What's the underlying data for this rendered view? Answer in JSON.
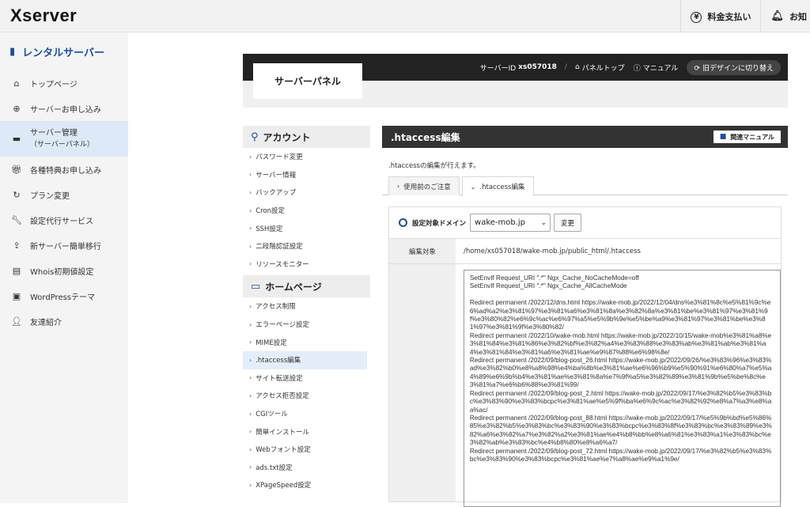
{
  "topbar": {
    "logo": "Xserver",
    "buttons": [
      {
        "label": "料金支払い",
        "icon": "yen-icon"
      },
      {
        "label": "お知",
        "icon": "bell-icon"
      }
    ]
  },
  "sidebar": {
    "title": "レンタルサーバー",
    "items": [
      {
        "label": "トップページ",
        "icon": "home-icon"
      },
      {
        "label": "サーバーお申し込み",
        "icon": "plus-circle-icon"
      },
      {
        "label": "サーバー管理",
        "sub": "（サーバーパネル）",
        "icon": "server-icon",
        "active": true
      },
      {
        "label": "各種特典お申し込み",
        "icon": "gift-icon"
      },
      {
        "label": "プラン変更",
        "icon": "refresh-icon"
      },
      {
        "label": "設定代行サービス",
        "icon": "wrench-icon"
      },
      {
        "label": "新サーバー簡単移行",
        "icon": "migrate-icon"
      },
      {
        "label": "Whois初期値設定",
        "icon": "document-icon"
      },
      {
        "label": "WordPressテーマ",
        "icon": "window-icon"
      },
      {
        "label": "友達紹介",
        "icon": "friend-icon"
      }
    ]
  },
  "panel": {
    "tab": "サーバーパネル",
    "server_id_label": "サーバーID",
    "server_id": "xs057018",
    "sep": "/",
    "panel_top": "パネルトップ",
    "manual": "マニュアル",
    "old_design": "旧デザインに切り替え"
  },
  "menu": {
    "account_title": "アカウント",
    "account_items": [
      "パスワード変更",
      "サーバー情報",
      "バックアップ",
      "Cron設定",
      "SSH設定",
      "二段階認証設定",
      "リソースモニター"
    ],
    "homepage_title": "ホームページ",
    "homepage_items": [
      "アクセス制限",
      "エラーページ設定",
      "MIME設定",
      ".htaccess編集",
      "サイト転送設定",
      "アクセス拒否設定",
      "CGIツール",
      "簡単インストール",
      "Webフォント設定",
      "ads.txt設定",
      "XPageSpeed設定"
    ]
  },
  "content": {
    "title": ".htaccess編集",
    "manual_btn": "関連マニュアル",
    "description": ".htaccessの編集が行えます。",
    "tabs": [
      ".htaccess編集"
    ],
    "tab_notes": "使用前のご注意",
    "domain_label": "設定対象ドメイン",
    "domain_value": "wake-mob.jp",
    "change_btn": "変更",
    "target_label": "編集対象",
    "target_value": "/home/xs057018/wake-mob.jp/public_html/.htaccess",
    "edit_label": "",
    "htaccess_text": "SetEnvIf Request_URI \".*\" Ngx_Cache_NoCacheMode=off\nSetEnvIf Request_URI \".*\" Ngx_Cache_AllCacheMode\n\nRedirect permanent /2022/12/dns.html https://wake-mob.jp/2022/12/04/dns%e3%81%8c%e5%81%9c%e6%ad%a2%e3%81%97%e3%81%a6%e3%81%8a%e3%82%8a%e3%81%be%e3%81%97%e3%81%9f%e3%80%82%e6%9c%ac%e6%97%a5%e5%9b%9e%e5%be%a9%e3%81%97%e3%81%be%e3%81%97%e3%81%9f%e3%80%82/\nRedirect permanent /2022/10/wake-mob.html https://wake-mob.jp/2022/10/15/wake-mob%e3%81%a8%e3%81%84%e3%81%86%e3%82%bf%e3%82%a4%e3%83%88%e3%83%ab%e3%81%ab%e3%81%a4%e3%81%84%e3%81%a6%e3%81%ae%e9%87%88%e6%98%8e/\nRedirect permanent /2022/09/blog-post_26.html https://wake-mob.jp/2022/09/26/%e3%83%96%e3%83%ad%e3%82%b0%e8%a8%98%e4%ba%8b%e3%81%ae%e6%96%b9%e5%90%91%e6%80%a7%e5%a4%89%e6%9b%b4%e3%81%ae%e3%81%8a%e7%9f%a5%e3%82%89%e3%81%9b%e5%be%8c%e3%81%a7%e6%b6%88%e3%81%99/\nRedirect permanent /2022/09/blog-post_2.html https://wake-mob.jp/2022/09/17/%e3%82%b5%e3%83%bc%e3%83%90%e3%83%bcpc%e3%81%ae%e5%9f%ba%e6%9c%ac%e3%82%92%e8%a7%a3%e8%aa%ac/\nRedirect permanent /2022/09/blog-post_88.html https://wake-mob.jp/2022/09/17/%e5%9b%bd%e5%86%85%e3%82%b5%e3%83%bc%e3%83%90%e3%83%bcpc%e3%83%8f%e3%83%bc%e3%83%89%e3%82%a6%e3%82%a7%e3%82%a2%e3%81%ae%e4%b8%bb%e8%a6%81%e3%83%a1%e3%83%bc%e3%82%ab%e3%83%bc%e4%b8%80%e8%a6%a7/\nRedirect permanent /2022/09/blog-post_72.html https://wake-mob.jp/2022/09/17/%e3%82%b5%e3%83%bc%e3%83%90%e3%83%bcpc%e3%81%ae%e7%a8%ae%e9%a1%9e/"
  }
}
